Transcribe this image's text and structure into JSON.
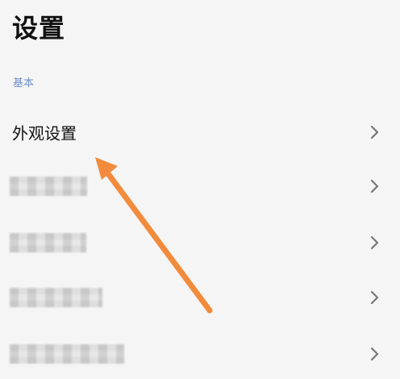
{
  "page": {
    "title": "设置"
  },
  "section": {
    "label": "基本"
  },
  "rows": [
    {
      "label": "外观设置",
      "chevron": "›"
    },
    {
      "label": "",
      "chevron": "›"
    },
    {
      "label": "",
      "chevron": "›"
    },
    {
      "label": "",
      "chevron": "›"
    },
    {
      "label": "",
      "chevron": "›"
    }
  ],
  "annotation": {
    "arrow_color": "#f28b3c"
  }
}
